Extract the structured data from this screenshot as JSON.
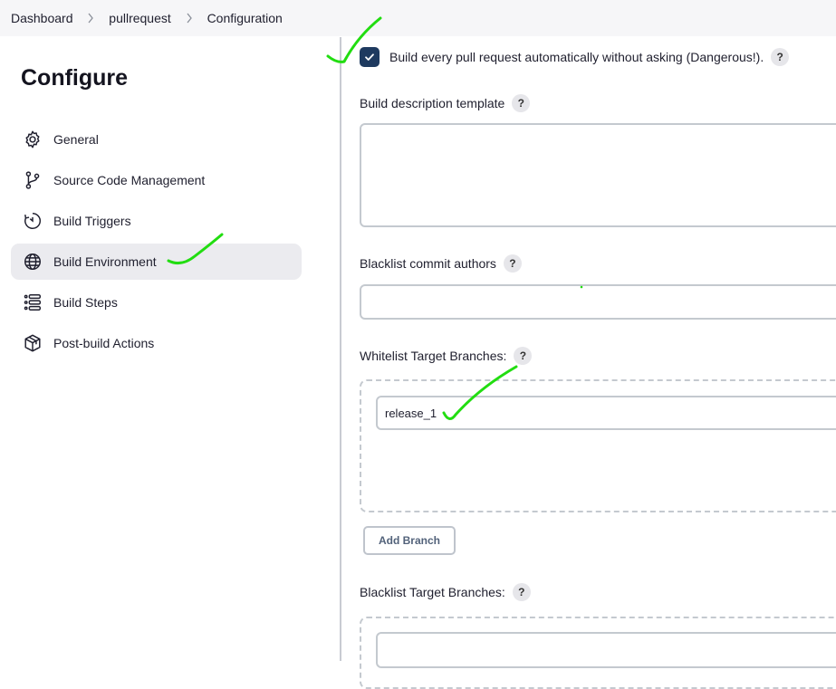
{
  "breadcrumb": {
    "items": [
      "Dashboard",
      "pullrequest",
      "Configuration"
    ]
  },
  "sidebar": {
    "title": "Configure",
    "items": [
      {
        "label": "General",
        "icon": "gear-icon"
      },
      {
        "label": "Source Code Management",
        "icon": "git-branch-icon"
      },
      {
        "label": "Build Triggers",
        "icon": "clock-icon"
      },
      {
        "label": "Build Environment",
        "icon": "globe-icon",
        "active": true
      },
      {
        "label": "Build Steps",
        "icon": "list-icon"
      },
      {
        "label": "Post-build Actions",
        "icon": "package-icon"
      }
    ]
  },
  "form": {
    "auto_build_label": "Build every pull request automatically without asking (Dangerous!).",
    "auto_build_checked": true,
    "description_template_label": "Build description template",
    "description_template_value": "",
    "blacklist_authors_label": "Blacklist commit authors",
    "blacklist_authors_value": "",
    "whitelist_branches_label": "Whitelist Target Branches:",
    "whitelist_branch_value": "release_1",
    "add_branch_label": "Add Branch",
    "blacklist_branches_label": "Blacklist Target Branches:",
    "help_glyph": "?"
  },
  "colors": {
    "accent_checkbox": "#1e3a5f",
    "annotation_marker": "#22dd11",
    "active_nav_bg": "#ebebef"
  }
}
